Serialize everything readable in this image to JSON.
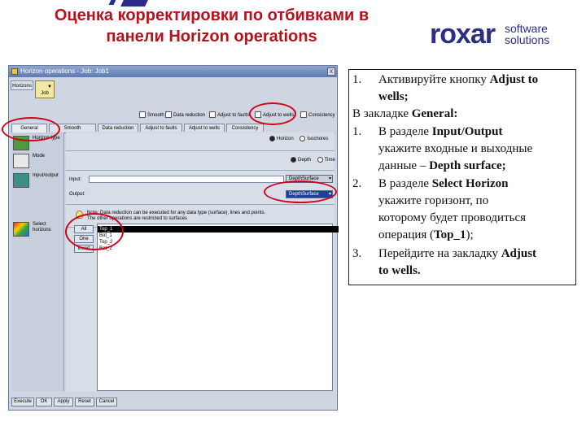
{
  "slide": {
    "title_line1": "Оценка корректировки по отбивками в",
    "title_line2": "панели Horizon operations",
    "logo_word": "roxar",
    "logo_sub1": "software",
    "logo_sub2": "solutions"
  },
  "window": {
    "title": "Horizon operations - Job: Job1",
    "close_glyph": "x",
    "toolbar": {
      "horizons_label": "Horizons",
      "job_label": "Job",
      "job_arrow": "▼"
    },
    "options": [
      {
        "label": "Smooth"
      },
      {
        "label": "Data reduction"
      },
      {
        "label": "Adjust to faults"
      },
      {
        "label": "Adjust to wells"
      },
      {
        "label": "Consistency"
      }
    ],
    "tabs": [
      "General",
      "Smooth",
      "Data reduction",
      "Adjust to faults",
      "Adjust to wells",
      "Consistency"
    ],
    "active_tab": "General",
    "left_items": [
      {
        "label": "Horizon type"
      },
      {
        "label": "Mode"
      },
      {
        "label": "Input/output"
      },
      {
        "label": "Select horizons"
      }
    ],
    "content": {
      "type_horizon": "Horizon",
      "type_isochore": "Isochores",
      "mode_depth": "Depth",
      "mode_time": "Time",
      "input_label": "Input:",
      "output_label": "Output:",
      "input_value": "DepthSurface",
      "output_value": "DepthSurface",
      "note_line1": "Note: Data reduction can be executed for any data type (surface), lines and points.",
      "note_line2": "The other operations are restricted to surfaces",
      "all_label": "All",
      "one_label": "One",
      "invert_label": "Invert",
      "horizons": [
        "Top_1",
        "Bot_1",
        "Top_2",
        "Bot_2"
      ],
      "selected_horizon": "Top_1"
    },
    "bottom_buttons": [
      "Execute",
      "OK",
      "Apply",
      "Reset",
      "Cancel"
    ]
  },
  "instructions": {
    "item1_num": "1.",
    "item1_text_a": "Активируйте кнопку ",
    "item1_text_b": "Adjust to",
    "item1_text_c": "wells;",
    "general_a": "В закладке ",
    "general_b": "General:",
    "item2_num": "1.",
    "item2_text_a": "В разделе ",
    "item2_text_b": "Input/Output",
    "item2_line2": "укажите входные и выходные",
    "item2_line3_a": "данные – ",
    "item2_line3_b": "Depth surface;",
    "item3_num": "2.",
    "item3_text_a": "В разделе ",
    "item3_text_b": "Select Horizon",
    "item3_line2": "укажите горизонт, по",
    "item3_line3": "которому будет проводиться",
    "item3_line4_a": "операция (",
    "item3_line4_b": "Top_1",
    "item3_line4_c": ");",
    "item4_num": "3.",
    "item4_text_a": "Перейдите на закладку ",
    "item4_text_b": "Adjust",
    "item4_line2": "to wells."
  },
  "colors": {
    "title_red": "#b5121b",
    "logo_blue": "#2b2e83",
    "highlight_red": "#d0021b"
  }
}
